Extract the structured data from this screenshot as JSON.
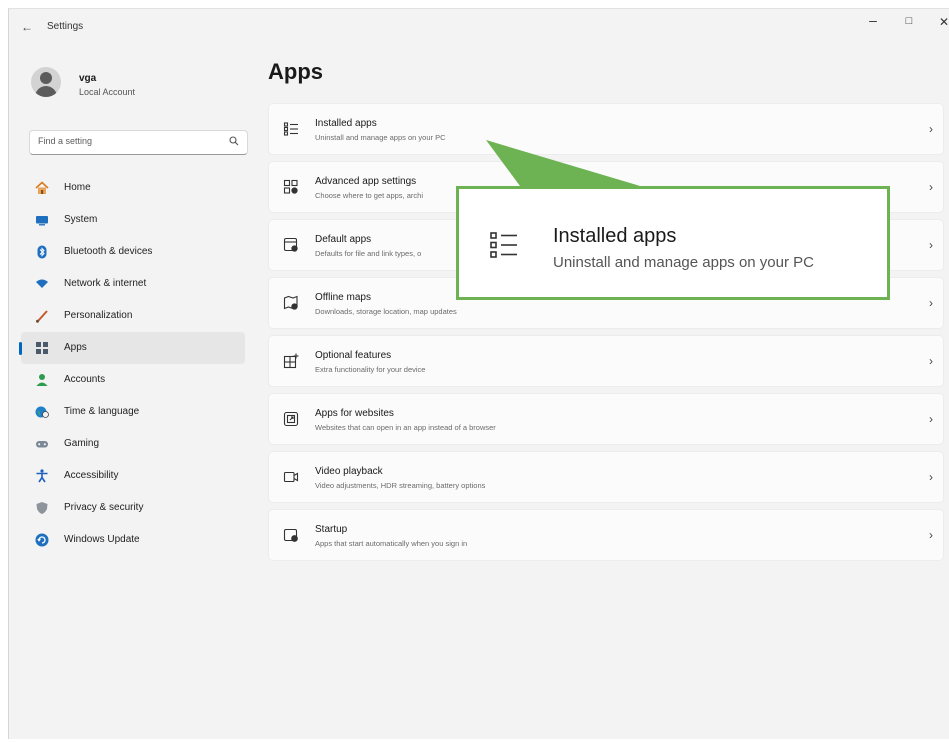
{
  "window": {
    "title": "Settings",
    "back_glyph": "←",
    "min_glyph": "–",
    "max_glyph": "□",
    "close_glyph": "✕"
  },
  "profile": {
    "name": "vga",
    "account_type": "Local Account"
  },
  "search": {
    "placeholder": "Find a setting",
    "icon": "search-icon"
  },
  "nav": [
    {
      "label": "Home",
      "icon": "home-icon",
      "selected": false
    },
    {
      "label": "System",
      "icon": "system-icon",
      "selected": false
    },
    {
      "label": "Bluetooth & devices",
      "icon": "bluetooth-icon",
      "selected": false
    },
    {
      "label": "Network & internet",
      "icon": "network-icon",
      "selected": false
    },
    {
      "label": "Personalization",
      "icon": "brush-icon",
      "selected": false
    },
    {
      "label": "Apps",
      "icon": "apps-icon",
      "selected": true
    },
    {
      "label": "Accounts",
      "icon": "accounts-icon",
      "selected": false
    },
    {
      "label": "Time & language",
      "icon": "globe-clock-icon",
      "selected": false
    },
    {
      "label": "Gaming",
      "icon": "gamepad-icon",
      "selected": false
    },
    {
      "label": "Accessibility",
      "icon": "accessibility-icon",
      "selected": false
    },
    {
      "label": "Privacy & security",
      "icon": "shield-icon",
      "selected": false
    },
    {
      "label": "Windows Update",
      "icon": "update-icon",
      "selected": false
    }
  ],
  "main": {
    "title": "Apps",
    "items": [
      {
        "title": "Installed apps",
        "desc": "Uninstall and manage apps on your PC",
        "icon": "list-icon"
      },
      {
        "title": "Advanced app settings",
        "desc": "Choose where to get apps, archi",
        "icon": "advanced-app-settings-icon"
      },
      {
        "title": "Default apps",
        "desc": "Defaults for file and link types, o",
        "icon": "default-apps-icon"
      },
      {
        "title": "Offline maps",
        "desc": "Downloads, storage location, map updates",
        "icon": "offline-maps-icon"
      },
      {
        "title": "Optional features",
        "desc": "Extra functionality for your device",
        "icon": "optional-features-icon"
      },
      {
        "title": "Apps for websites",
        "desc": "Websites that can open in an app instead of a browser",
        "icon": "apps-for-websites-icon"
      },
      {
        "title": "Video playback",
        "desc": "Video adjustments, HDR streaming, battery options",
        "icon": "video-icon"
      },
      {
        "title": "Startup",
        "desc": "Apps that start automatically when you sign in",
        "icon": "startup-icon"
      }
    ],
    "chevron": "›"
  },
  "callout": {
    "title": "Installed apps",
    "desc": "Uninstall and manage apps on your PC",
    "border_color": "#6db253",
    "icon": "list-icon"
  },
  "colors": {
    "accent": "#0067c0",
    "callout_green": "#6db253",
    "window_bg": "#f3f3f3"
  }
}
